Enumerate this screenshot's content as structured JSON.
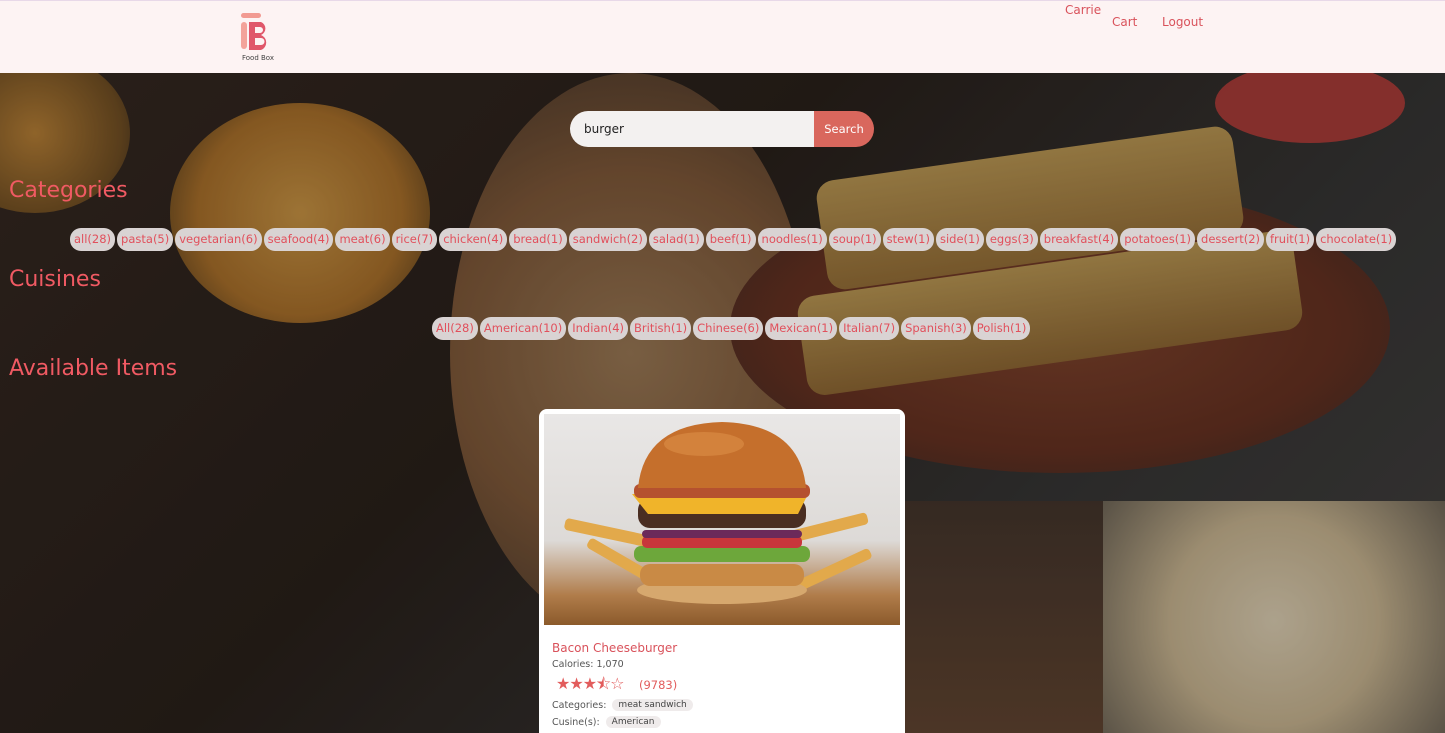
{
  "header": {
    "logo_text": "Food Box",
    "user_name": "Carrie",
    "cart_label": "Cart",
    "logout_label": "Logout"
  },
  "search": {
    "value": "burger",
    "button_label": "Search"
  },
  "sections": {
    "categories": "Categories",
    "cuisines": "Cuisines",
    "available_items": "Available Items"
  },
  "categories": [
    "all(28)",
    "pasta(5)",
    "vegetarian(6)",
    "seafood(4)",
    "meat(6)",
    "rice(7)",
    "chicken(4)",
    "bread(1)",
    "sandwich(2)",
    "salad(1)",
    "beef(1)",
    "noodles(1)",
    "soup(1)",
    "stew(1)",
    "side(1)",
    "eggs(3)",
    "breakfast(4)",
    "potatoes(1)",
    "dessert(2)",
    "fruit(1)",
    "chocolate(1)"
  ],
  "cuisines": [
    "All(28)",
    "American(10)",
    "Indian(4)",
    "British(1)",
    "Chinese(6)",
    "Mexican(1)",
    "Italian(7)",
    "Spanish(3)",
    "Polish(1)"
  ],
  "item": {
    "name": "Bacon Cheeseburger",
    "calories": "Calories: 1,070",
    "stars_text": "★★★⯪☆",
    "rating": 3.5,
    "rating_count": "(9783)",
    "categories_label": "Categories:",
    "categories_value": "meat sandwich",
    "cuisines_label": "Cusine(s):",
    "cuisines_value": "American"
  },
  "colors": {
    "accent": "#f05a63",
    "search_button": "#d9675d",
    "header_bg": "#fdf3f3",
    "chip_bg": "#d9d3d3"
  }
}
